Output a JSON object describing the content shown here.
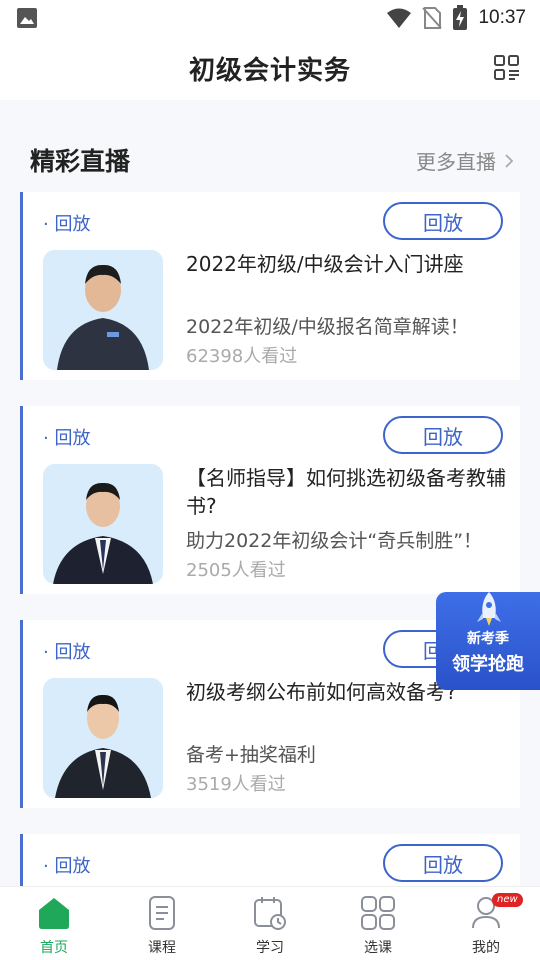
{
  "status_bar": {
    "time": "10:37"
  },
  "header": {
    "title": "初级会计实务"
  },
  "section": {
    "title": "精彩直播",
    "more_label": "更多直播"
  },
  "cards": [
    {
      "tag": "· 回放",
      "button": "回放",
      "title": "2022年初级/中级会计入门讲座",
      "subtitle": "2022年初级/中级报名简章解读！",
      "viewers": "62398人看过"
    },
    {
      "tag": "· 回放",
      "button": "回放",
      "title": "【名师指导】如何挑选初级备考教辅书?",
      "subtitle": "助力2022年初级会计“奇兵制胜”！",
      "viewers": "2505人看过"
    },
    {
      "tag": "· 回放",
      "button": "回放",
      "title": "初级考纲公布前如何高效备考?",
      "subtitle": "备考+抽奖福利",
      "viewers": "3519人看过"
    },
    {
      "tag": "· 回放",
      "button": "回放"
    }
  ],
  "promo": {
    "line1": "新考季",
    "line2": "领学抢跑"
  },
  "nav": {
    "items": [
      {
        "label": "首页"
      },
      {
        "label": "课程"
      },
      {
        "label": "学习"
      },
      {
        "label": "选课"
      },
      {
        "label": "我的",
        "badge": "new"
      }
    ]
  },
  "colors": {
    "accent_blue": "#3d64c8",
    "active_green": "#1fa85a",
    "badge_red": "#e02424"
  }
}
